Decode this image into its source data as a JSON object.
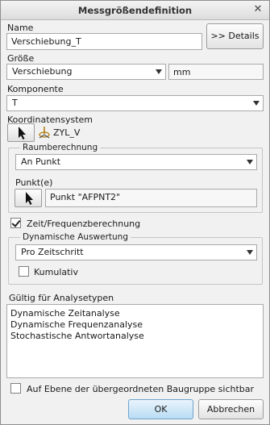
{
  "dialog": {
    "title": "Messgrößendefinition"
  },
  "name": {
    "label": "Name",
    "value": "Verschiebung_T",
    "details_button": ">> Details"
  },
  "groesse": {
    "label": "Größe",
    "selected": "Verschiebung",
    "unit": "mm"
  },
  "komponente": {
    "label": "Komponente",
    "selected": "T"
  },
  "koordinatensystem": {
    "label": "Koordinatensystem",
    "value": "ZYL_V"
  },
  "raumberechnung": {
    "title": "Raumberechnung",
    "selected": "An Punkt",
    "punkt_label": "Punkt(e)",
    "punkt_value": "Punkt \"AFPNT2\""
  },
  "zeit_frequenz": {
    "label": "Zeit/Frequenzberechnung",
    "checked": true
  },
  "dynamische_auswertung": {
    "title": "Dynamische Auswertung",
    "selected": "Pro Zeitschritt",
    "kumulativ_label": "Kumulativ",
    "kumulativ_checked": false
  },
  "analysetypen": {
    "label": "Gültig für Analysetypen",
    "items": [
      "Dynamische Zeitanalyse",
      "Dynamische Frequenzanalyse",
      "Stochastische Antwortanalyse"
    ]
  },
  "ebene": {
    "label": "Auf Ebene der übergeordneten Baugruppe sichtbar",
    "checked": false
  },
  "footer": {
    "ok": "OK",
    "cancel": "Abbrechen"
  }
}
